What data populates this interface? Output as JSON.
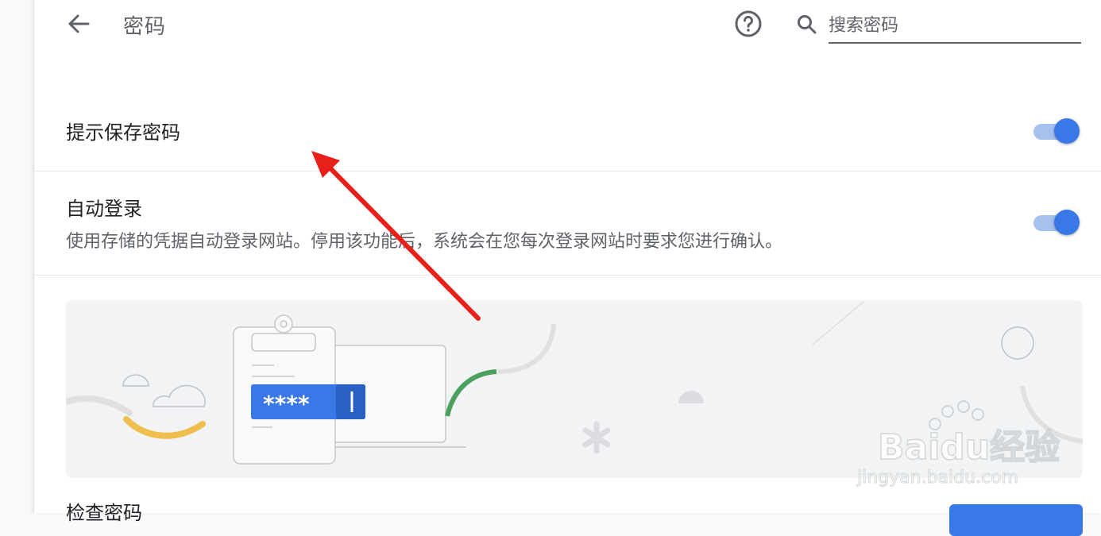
{
  "header": {
    "title": "密码",
    "back_icon": "arrow-left-icon",
    "help_icon": "help-circle-icon",
    "search": {
      "icon": "search-icon",
      "placeholder": "搜索密码",
      "value": ""
    }
  },
  "settings": [
    {
      "label": "提示保存密码",
      "enabled": true
    },
    {
      "label": "自动登录",
      "description": "使用存储的凭据自动登录网站。停用该功能后，系统会在您每次登录网站时要求您进行确认。",
      "enabled": true
    }
  ],
  "illustration": {
    "password_mask": "****"
  },
  "bottom": {
    "label": "检查密码"
  },
  "watermark": {
    "brand_text": "Baidu经验",
    "url_text": "jingyan.baidu.com"
  },
  "colors": {
    "accent": "#3b78e7",
    "toggle_track": "#a7c1ef",
    "annotation_arrow": "#e8201a"
  }
}
